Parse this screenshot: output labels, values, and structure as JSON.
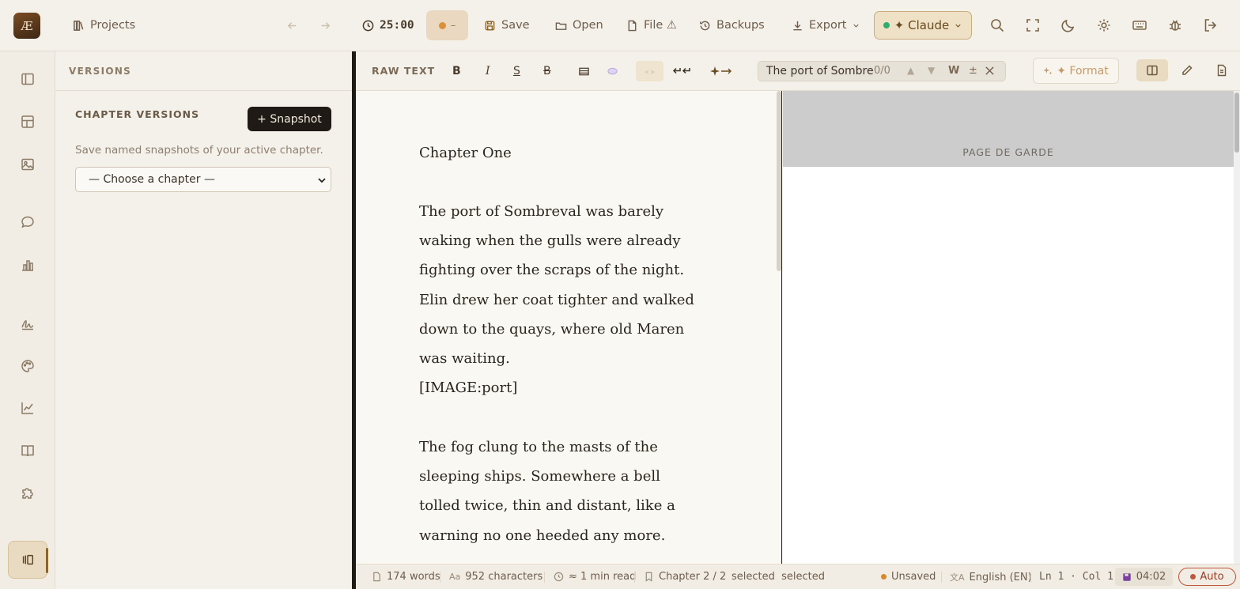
{
  "app": {
    "logo_text": "Æ"
  },
  "topbar": {
    "projects_label": "Projects",
    "timer": "25:00",
    "status_pill": "–",
    "save_label": "Save",
    "open_label": "Open",
    "file_label": "File ⚠",
    "backups_label": "Backups",
    "export_label": "Export",
    "ai_label": "✦ Claude"
  },
  "versions_panel": {
    "header": "VERSIONS",
    "section_title": "CHAPTER VERSIONS",
    "snapshot_button": "+ Snapshot",
    "description": "Save named snapshots of your active chapter.",
    "chapter_select": "— Choose a chapter —"
  },
  "editor_toolbar": {
    "mode_label": "RAW TEXT",
    "bold": "B",
    "italic": "I",
    "underline": "S",
    "strike": "B",
    "find_value": "The port of Sombre",
    "find_count": "0/0",
    "whole_word": "W",
    "plus_minus": "±",
    "format_label": "✦ Format"
  },
  "editor": {
    "paragraphs": [
      "Chapter One",
      "The port of Sombreval was barely waking when the gulls were already fighting over the scraps of the night. Elin drew her coat tighter and walked down to the quays, where old Maren was waiting.",
      "[IMAGE:port]",
      "The fog clung to the masts of the sleeping ships. Somewhere a bell tolled twice, thin and distant, like a warning no one heeded any more."
    ]
  },
  "preview": {
    "page_label": "PAGE DE GARDE"
  },
  "statusbar": {
    "words": "174 words",
    "characters": "952 characters",
    "read_time": "≈ 1 min read",
    "chapter": "Chapter 2 / 2",
    "selected": "selected  selected",
    "save_state": "Unsaved",
    "language": "English (EN)",
    "cursor": "Ln 1 · Col 1",
    "autosave_time": "04:02",
    "auto_label": "Auto"
  },
  "colors": {
    "accent": "#8b6530",
    "dark_button": "#1f1a15",
    "unsaved": "#d68a2e",
    "ai_dot": "#2fae6d"
  }
}
